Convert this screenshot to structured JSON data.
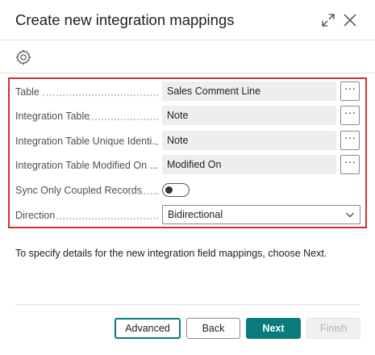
{
  "dialog": {
    "title": "Create new integration mappings",
    "icons": {
      "expand": "expand-icon",
      "close": "close-icon",
      "settings": "gear-icon"
    }
  },
  "fields": [
    {
      "label": "Table",
      "value": "Sales Comment Line"
    },
    {
      "label": "Integration Table",
      "value": "Note"
    },
    {
      "label": "Integration Table Unique Identi...",
      "value": "Note"
    },
    {
      "label": "Integration Table Modified On ...",
      "value": "Modified On"
    }
  ],
  "lookup_label": "···",
  "sync_only_coupled": {
    "label": "Sync Only Coupled Records",
    "on": false
  },
  "direction": {
    "label": "Direction",
    "value": "Bidirectional"
  },
  "instruction": "To specify details for the new integration field mappings, choose Next.",
  "buttons": {
    "advanced": "Advanced",
    "back": "Back",
    "next": "Next",
    "finish": "Finish"
  },
  "colors": {
    "accent": "#0a7b7b",
    "highlight_border": "#d32f2f"
  }
}
